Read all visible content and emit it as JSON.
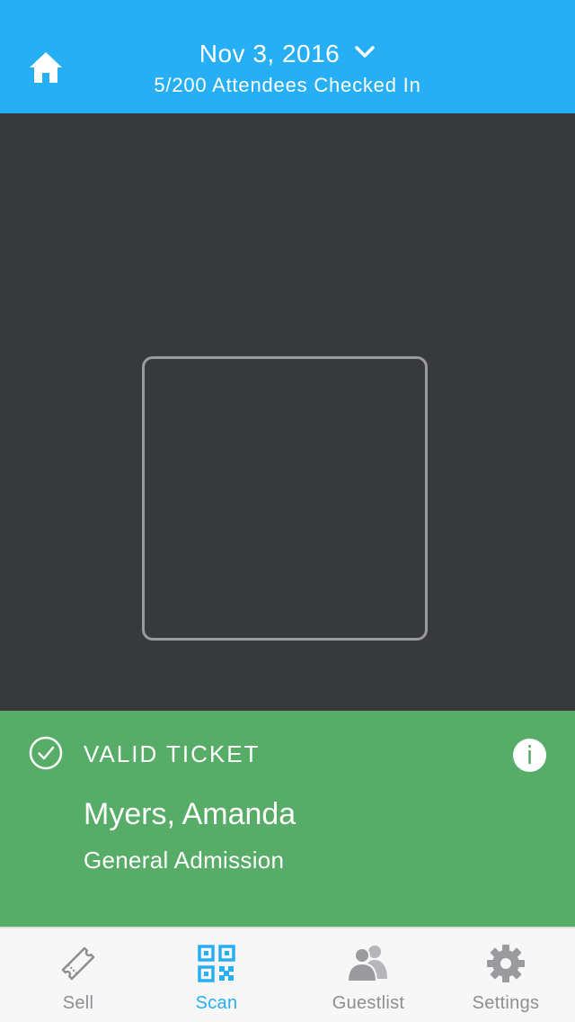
{
  "header": {
    "date": "Nov 3, 2016",
    "checkin_status": "5/200 Attendees Checked In",
    "home_icon": "home-icon",
    "dropdown_icon": "chevron-down-icon",
    "background_color": "#26aff4"
  },
  "scanner": {
    "background_color": "#38393d"
  },
  "result": {
    "status_label": "VALID TICKET",
    "status_icon": "check-circle-icon",
    "info_label": "i",
    "attendee_name": "Myers, Amanda",
    "ticket_type": "General Admission",
    "background_color": "#57ad67"
  },
  "tabbar": {
    "active_color": "#26aff4",
    "inactive_color": "#8e8e93",
    "tabs": [
      {
        "label": "Sell",
        "icon": "ticket-icon",
        "active": false
      },
      {
        "label": "Scan",
        "icon": "qr-code-icon",
        "active": true
      },
      {
        "label": "Guestlist",
        "icon": "people-icon",
        "active": false
      },
      {
        "label": "Settings",
        "icon": "gear-icon",
        "active": false
      }
    ]
  }
}
